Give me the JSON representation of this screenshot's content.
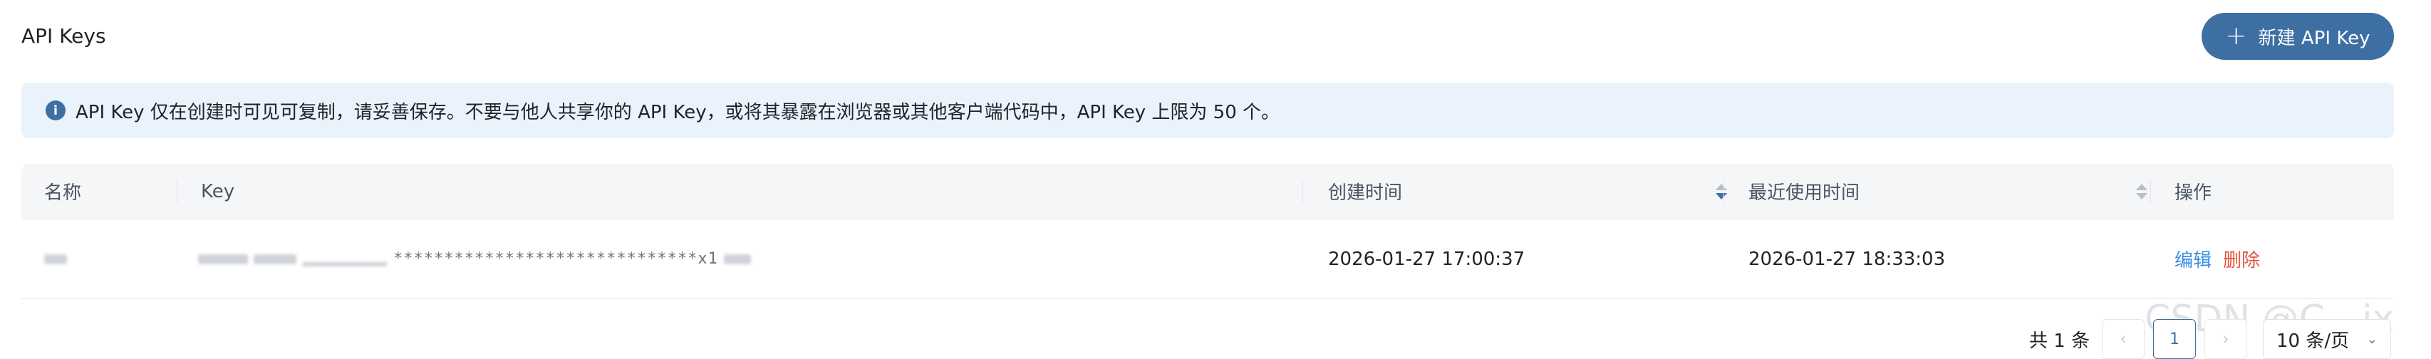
{
  "header": {
    "title": "API Keys",
    "new_button": "新建 API Key"
  },
  "notice": {
    "text": "API Key 仅在创建时可见可复制，请妥善保存。不要与他人共享你的 API Key，或将其暴露在浏览器或其他客户端代码中，API Key 上限为 50 个。"
  },
  "table": {
    "columns": {
      "name": "名称",
      "key": "Key",
      "created": "创建时间",
      "last_used": "最近使用时间",
      "actions": "操作"
    },
    "rows": [
      {
        "key_masked": "******************************x1",
        "created": "2026-01-27 17:00:37",
        "last_used": "2026-01-27 18:33:03",
        "edit": "编辑",
        "delete": "删除"
      }
    ]
  },
  "pagination": {
    "total": "共 1 条",
    "prev": "‹",
    "current_page": "1",
    "next": "›",
    "page_size": "10 条/页"
  },
  "watermark": "CSDN @C__jx",
  "icons": {
    "new": "plus-icon",
    "notice": "info-icon",
    "sort": "sort-icon",
    "size": "chevron-down-icon"
  },
  "colors": {
    "primary": "#3d6fa2",
    "notice_bg": "#eaf3fb",
    "link": "#3b8ee0",
    "danger": "#e5533f"
  }
}
